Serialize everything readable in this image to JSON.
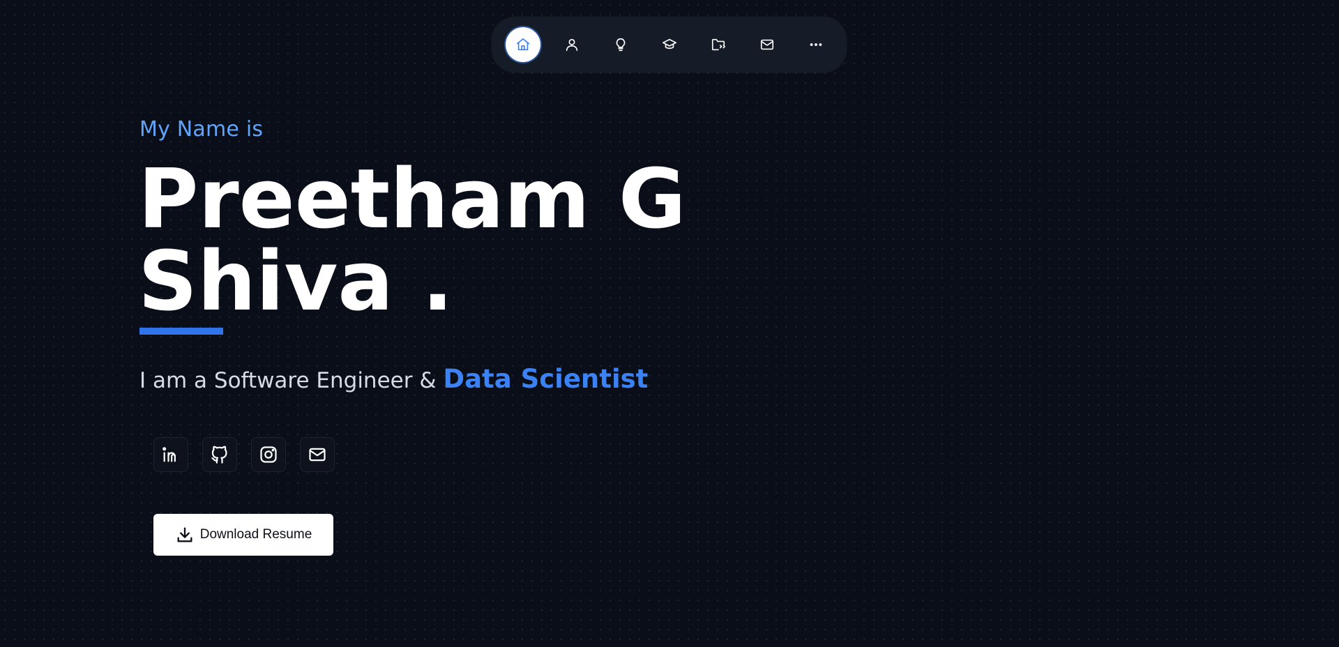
{
  "nav": {
    "items": [
      {
        "icon": "home-icon",
        "active": true
      },
      {
        "icon": "user-icon",
        "active": false
      },
      {
        "icon": "lightbulb-icon",
        "active": false
      },
      {
        "icon": "graduation-cap-icon",
        "active": false
      },
      {
        "icon": "folder-code-icon",
        "active": false
      },
      {
        "icon": "mail-icon",
        "active": false
      },
      {
        "icon": "more-horizontal-icon",
        "active": false
      }
    ]
  },
  "hero": {
    "intro": "My Name is",
    "name_line1": "Preetham G",
    "name_line2": "Shiva .",
    "tagline_prefix": "I am a Software Engineer & ",
    "tagline_highlight": "Data Scientist"
  },
  "socials": [
    {
      "icon": "linkedin-icon"
    },
    {
      "icon": "github-icon"
    },
    {
      "icon": "instagram-icon"
    },
    {
      "icon": "mail-icon"
    }
  ],
  "download": {
    "label": "Download Resume",
    "icon": "download-icon"
  },
  "colors": {
    "background": "#0a0e18",
    "accent": "#3b82f6",
    "intro_text": "#60a5fa",
    "nav_bg": "#151b27"
  }
}
